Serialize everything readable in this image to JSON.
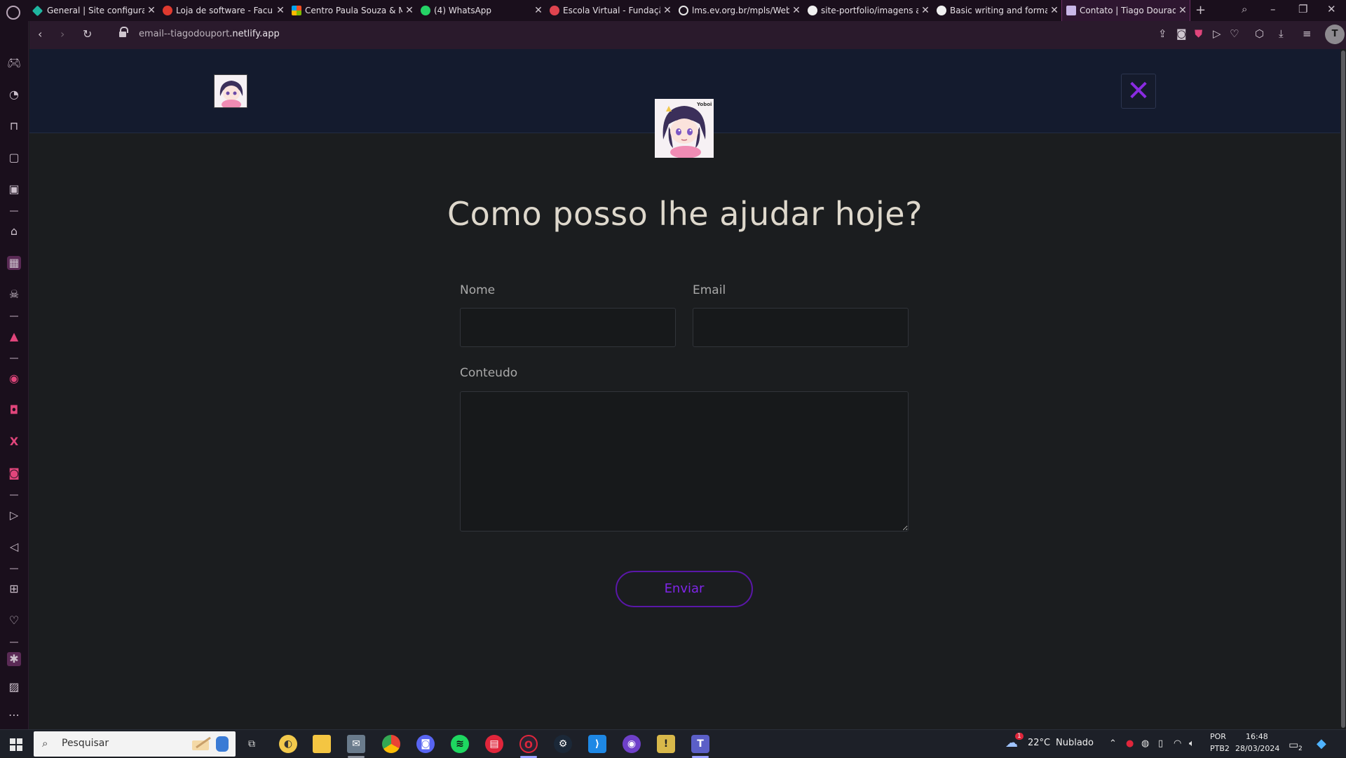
{
  "browser": {
    "tabs": [
      {
        "title": "General | Site configurati",
        "favicon_color": "#1fb5a0"
      },
      {
        "title": "Loja de software - Faculd",
        "favicon_color": "#e03a2f"
      },
      {
        "title": "Centro Paula Souza & Mi",
        "favicon_color": "#f2a900"
      },
      {
        "title": "(4) WhatsApp",
        "favicon_color": "#25d366"
      },
      {
        "title": "Escola Virtual - Fundação",
        "favicon_color": "#e0444f"
      },
      {
        "title": "lms.ev.org.br/mpls/Web",
        "favicon_color": "#e8e8e8"
      },
      {
        "title": "site-portfolio/imagens a",
        "favicon_color": "#f0f0f0"
      },
      {
        "title": "Basic writing and formatt",
        "favicon_color": "#f0f0f0"
      },
      {
        "title": "Contato | Tiago Dourado",
        "favicon_color": "#c9b7e8",
        "active": true
      }
    ],
    "tab_close_glyph": "✕",
    "new_tab_glyph": "+",
    "url_prefix": "email--tiagodouport",
    "url_domain": ".netlify.app",
    "profile_initial": "T"
  },
  "page": {
    "heading": "Como posso lhe ajudar hoje?",
    "name_label": "Nome",
    "name_value": "",
    "email_label": "Email",
    "email_value": "",
    "content_label": "Conteudo",
    "content_value": "",
    "submit_label": "Enviar",
    "close_glyph": "✕",
    "logo_caption": "Yoboi",
    "accent_color": "#8a2be2"
  },
  "taskbar": {
    "search_placeholder": "Pesquisar",
    "weather_temp": "22°C",
    "weather_text": "Nublado",
    "weather_alert_count": "1",
    "language": "POR",
    "keyboard": "PTB2",
    "time": "16:48",
    "date": "28/03/2024",
    "notification_count": "2",
    "apps": [
      "task-view",
      "files-manager",
      "file-explorer",
      "mail",
      "chrome",
      "discord",
      "spotify",
      "anydesk",
      "opera",
      "steam",
      "vscode",
      "github-desktop",
      "security-app",
      "teams"
    ]
  }
}
